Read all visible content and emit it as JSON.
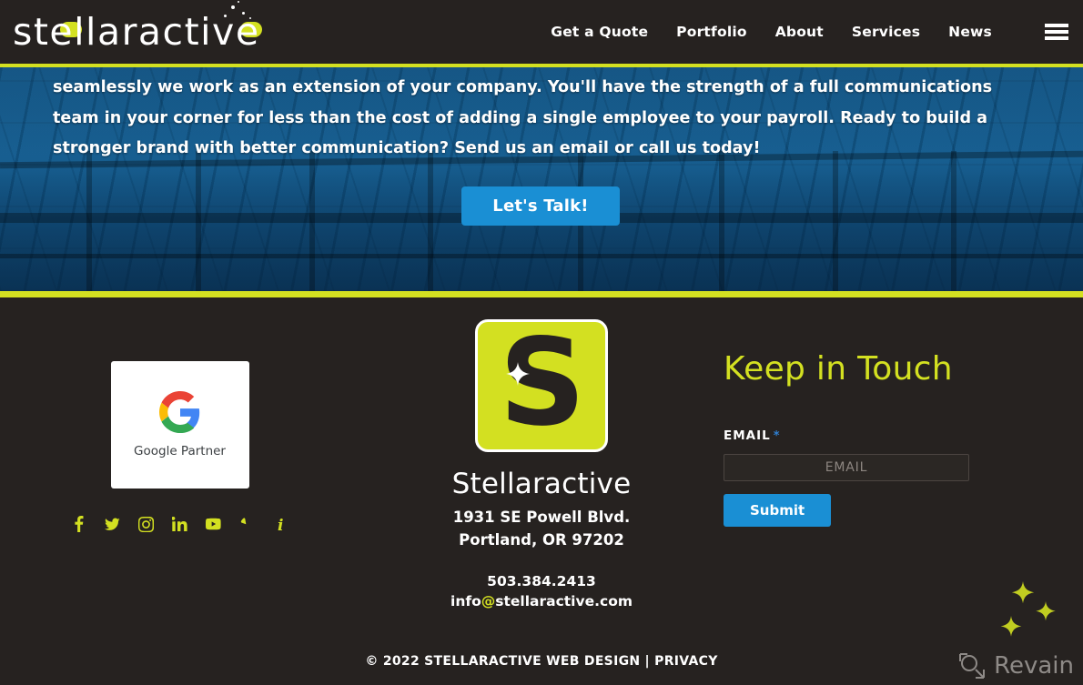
{
  "header": {
    "logo_text": "stellaractive",
    "nav": [
      {
        "label": "Get a Quote"
      },
      {
        "label": "Portfolio"
      },
      {
        "label": "About"
      },
      {
        "label": "Services"
      },
      {
        "label": "News"
      }
    ],
    "menu_icon": "hamburger-icon"
  },
  "hero": {
    "paragraph": "seamlessly we work as an extension of your company. You'll have the strength of a full communications team in your corner for less than the cost of adding a single employee to your payroll. Ready to build a stronger brand with better communication? Send us an email or call us today!",
    "cta_label": "Let's Talk!"
  },
  "footer": {
    "google_badge": {
      "label": "Google Partner",
      "icon": "google-g-icon"
    },
    "socials": [
      {
        "name": "facebook-icon"
      },
      {
        "name": "twitter-icon"
      },
      {
        "name": "instagram-icon"
      },
      {
        "name": "linkedin-icon"
      },
      {
        "name": "youtube-icon"
      },
      {
        "name": "yelp-icon"
      },
      {
        "name": "info-icon"
      }
    ],
    "brand": {
      "badge_letter": "S",
      "name": "Stellaractive",
      "address_line1": "1931 SE Powell Blvd.",
      "address_line2": "Portland, OR 97202",
      "phone": "503.384.2413",
      "email_user": "info",
      "email_at": "@",
      "email_domain": "stellaractive.com"
    },
    "keep_in_touch": {
      "title": "Keep in Touch",
      "email_label": "EMAIL",
      "required_mark": "*",
      "email_value": "",
      "email_placeholder": "EMAIL",
      "submit_label": "Submit"
    },
    "copyright": "© 2022 STELLARACTIVE WEB DESIGN | PRIVACY"
  },
  "watermark": {
    "label": "Revain"
  },
  "colors": {
    "accent_yellow": "#d3e021",
    "dark_bg": "#262220",
    "hero_blue": "#16699f",
    "button_blue": "#1a8fd4",
    "required_blue": "#2f7fd1"
  }
}
